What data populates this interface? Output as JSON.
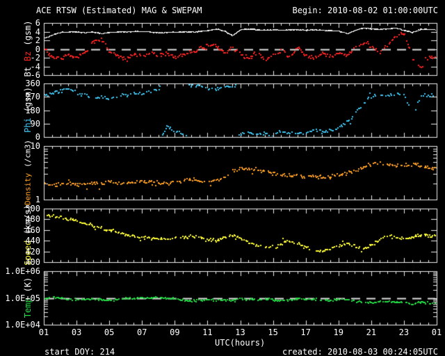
{
  "title": "ACE RTSW (Estimated) MAG & SWEPAM",
  "begin_label": "Begin: 2010-08-02 01:00:00UTC",
  "footer": {
    "start_doy": "start DOY: 214",
    "created": "created: 2010-08-03 00:24:05UTC"
  },
  "x_axis": {
    "label": "UTC(hours)",
    "ticks": [
      {
        "label": "01",
        "hour": 1
      },
      {
        "label": "03",
        "hour": 3
      },
      {
        "label": "05",
        "hour": 5
      },
      {
        "label": "07",
        "hour": 7
      },
      {
        "label": "09",
        "hour": 9
      },
      {
        "label": "11",
        "hour": 11
      },
      {
        "label": "13",
        "hour": 13
      },
      {
        "label": "15",
        "hour": 15
      },
      {
        "label": "17",
        "hour": 17
      },
      {
        "label": "19",
        "hour": 19
      },
      {
        "label": "21",
        "hour": 21
      },
      {
        "label": "23",
        "hour": 23
      },
      {
        "label": "01",
        "hour": 25
      }
    ]
  },
  "colors": {
    "background": "#000000",
    "frame": "#f0f0f0",
    "dashed": "#e0e0e0",
    "bt": "#ffffff",
    "bz": "#ff2222",
    "phi": "#3fc8f4",
    "density": "#ffa022",
    "speed": "#ffff33",
    "temp": "#22dd44"
  },
  "chart_data": [
    {
      "type": "scatter",
      "panel": "bt_bz",
      "scale": "linear",
      "ylim": [
        -6,
        6
      ],
      "dashed_at": 0,
      "ylabel_parts": [
        {
          "text": "Bt",
          "color": "#ffffff"
        },
        {
          "text": "Bz",
          "color": "#ff2222"
        },
        {
          "text": "(gsm)",
          "color": "#ffffff"
        }
      ],
      "yticks": [
        {
          "label": "6",
          "value": 6
        },
        {
          "label": "4",
          "value": 4
        },
        {
          "label": "2",
          "value": 2
        },
        {
          "label": "0",
          "value": 0
        },
        {
          "label": "-2",
          "value": -2
        },
        {
          "label": "-4",
          "value": -4
        },
        {
          "label": "-6",
          "value": -6
        }
      ],
      "x_start": 1,
      "x_step": 0.5,
      "series": [
        {
          "name": "Bt",
          "color": "#ffffff",
          "values": [
            2.6,
            3.3,
            3.9,
            4.0,
            4.0,
            3.8,
            4.0,
            3.6,
            3.9,
            4.0,
            4.0,
            4.1,
            4.1,
            4.0,
            3.8,
            3.9,
            3.9,
            4.0,
            4.0,
            4.1,
            4.3,
            4.7,
            4.2,
            3.2,
            4.5,
            4.7,
            4.5,
            4.4,
            4.5,
            4.4,
            4.5,
            4.5,
            4.4,
            4.5,
            4.4,
            4.3,
            4.2,
            3.6,
            4.4,
            4.9,
            4.7,
            4.6,
            4.7,
            4.9,
            4.3,
            3.9,
            4.6,
            4.6,
            4.4
          ]
        },
        {
          "name": "Bz",
          "color": "#ff2222",
          "values": [
            0.2,
            -1.6,
            -2.1,
            -1.2,
            -1.9,
            -0.6,
            1.6,
            2.4,
            -0.6,
            -1.4,
            -2.2,
            -0.9,
            -1.4,
            -0.7,
            -1.2,
            -0.9,
            -1.8,
            -1.1,
            -0.7,
            0.3,
            0.9,
            1.1,
            -0.9,
            0.4,
            -1.1,
            -2.1,
            -0.4,
            -2.6,
            -1.1,
            -0.3,
            -1.7,
            0.4,
            -1.3,
            -2.1,
            -0.7,
            -1.7,
            -0.7,
            -1.4,
            0.6,
            1.5,
            0.8,
            -0.6,
            1.0,
            3.4,
            3.6,
            -2.2,
            -4.3,
            -1.6,
            -2.1
          ]
        }
      ]
    },
    {
      "type": "scatter",
      "panel": "phi",
      "scale": "linear",
      "ylim": [
        0,
        360
      ],
      "ylabel_parts": [
        {
          "text": "Phi",
          "color": "#3fc8f4"
        },
        {
          "text": "(gsm)",
          "color": "#ffffff"
        }
      ],
      "yticks": [
        {
          "label": "360",
          "value": 360
        },
        {
          "label": "270",
          "value": 270
        },
        {
          "label": "180",
          "value": 180
        },
        {
          "label": "90",
          "value": 90
        },
        {
          "label": "0",
          "value": 0
        }
      ],
      "x_start": 1,
      "x_step": 0.5,
      "series": [
        {
          "name": "Phi",
          "color": "#3fc8f4",
          "wrap360": true,
          "values": [
            285,
            300,
            315,
            330,
            300,
            280,
            265,
            275,
            260,
            290,
            280,
            300,
            295,
            310,
            330,
            80,
            40,
            20,
            340,
            350,
            330,
            320,
            345,
            340,
            25,
            40,
            15,
            30,
            20,
            45,
            30,
            25,
            40,
            55,
            35,
            50,
            70,
            100,
            160,
            230,
            275,
            290,
            280,
            295,
            285,
            150,
            280,
            285,
            290
          ]
        }
      ]
    },
    {
      "type": "scatter",
      "panel": "density",
      "scale": "log",
      "ylim": [
        1,
        10
      ],
      "ylabel_parts": [
        {
          "text": "Density",
          "color": "#ffa022"
        },
        {
          "text": "(/cm3)",
          "color": "#ffffff"
        }
      ],
      "yticks": [
        {
          "label": "10",
          "value": 10
        },
        {
          "label": "1",
          "value": 1
        }
      ],
      "x_start": 1,
      "x_step": 0.5,
      "series": [
        {
          "name": "Density",
          "color": "#ffa022",
          "values": [
            2.0,
            1.9,
            2.0,
            2.1,
            1.9,
            2.0,
            2.1,
            2.0,
            2.2,
            2.1,
            2.0,
            2.2,
            2.3,
            2.2,
            2.1,
            2.0,
            2.2,
            2.3,
            2.4,
            2.3,
            2.2,
            2.4,
            2.6,
            3.6,
            4.0,
            3.8,
            3.6,
            3.4,
            3.2,
            3.0,
            2.8,
            3.0,
            2.7,
            2.9,
            2.6,
            2.8,
            3.0,
            3.2,
            3.6,
            4.2,
            4.6,
            4.8,
            4.5,
            4.3,
            4.5,
            4.6,
            4.3,
            4.1,
            3.9
          ]
        }
      ]
    },
    {
      "type": "scatter",
      "panel": "speed",
      "scale": "linear",
      "ylim": [
        400,
        500
      ],
      "ylabel_parts": [
        {
          "text": "Speed",
          "color": "#ffff33"
        },
        {
          "text": "(km/s)",
          "color": "#ffffff"
        }
      ],
      "yticks": [
        {
          "label": "500",
          "value": 500
        },
        {
          "label": "480",
          "value": 480
        },
        {
          "label": "460",
          "value": 460
        },
        {
          "label": "440",
          "value": 440
        },
        {
          "label": "420",
          "value": 420
        },
        {
          "label": "400",
          "value": 400
        }
      ],
      "x_start": 1,
      "x_step": 0.5,
      "series": [
        {
          "name": "Speed",
          "color": "#ffff33",
          "values": [
            490,
            487,
            484,
            481,
            477,
            473,
            469,
            464,
            460,
            457,
            453,
            450,
            448,
            446,
            445,
            444,
            446,
            448,
            450,
            447,
            444,
            442,
            448,
            452,
            446,
            438,
            432,
            430,
            428,
            434,
            442,
            436,
            428,
            424,
            421,
            426,
            432,
            436,
            430,
            426,
            433,
            444,
            450,
            447,
            445,
            449,
            452,
            450,
            451
          ]
        }
      ]
    },
    {
      "type": "scatter",
      "panel": "temp",
      "scale": "log",
      "ylim": [
        10000,
        1000000
      ],
      "dashed_at": 100000,
      "ylabel_parts": [
        {
          "text": "Temp",
          "color": "#22dd44"
        },
        {
          "text": "(K)",
          "color": "#ffffff"
        }
      ],
      "yticks": [
        {
          "label": "1.0E+06",
          "value": 1000000
        },
        {
          "label": "1.0E+05",
          "value": 100000
        },
        {
          "label": "1.0E+04",
          "value": 10000
        }
      ],
      "x_start": 1,
      "x_step": 0.5,
      "series": [
        {
          "name": "Temp",
          "color": "#22dd44",
          "values": [
            100000,
            115000,
            105000,
            95000,
            90000,
            95000,
            100000,
            90000,
            85000,
            95000,
            105000,
            100000,
            110000,
            105000,
            115000,
            100000,
            95000,
            85000,
            80000,
            85000,
            90000,
            85000,
            95000,
            90000,
            100000,
            95000,
            90000,
            95000,
            90000,
            85000,
            90000,
            95000,
            100000,
            95000,
            90000,
            85000,
            95000,
            90000,
            80000,
            75000,
            70000,
            75000,
            80000,
            75000,
            70000,
            60000,
            75000,
            70000,
            65000
          ]
        }
      ]
    }
  ]
}
